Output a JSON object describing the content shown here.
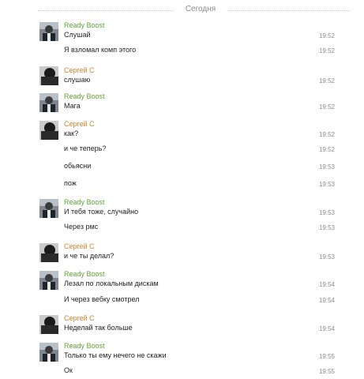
{
  "day_separator": "Сегодня",
  "users": {
    "ready_boost": {
      "name": "Ready Boost",
      "color": "#5fa535"
    },
    "sergey": {
      "name": "Сергей С",
      "color": "#d9822b"
    }
  },
  "messages": [
    {
      "text": "Слушай",
      "time": "19:52"
    },
    {
      "text": "Я взломал комп этого",
      "time": "19:52"
    },
    {
      "text": "слушаю",
      "time": "19:52"
    },
    {
      "text": "Мага",
      "time": "19:52"
    },
    {
      "text": "как?",
      "time": "19:52"
    },
    {
      "text": "и че теперь?",
      "time": "19:52"
    },
    {
      "text": "обьясни",
      "time": "19:53"
    },
    {
      "text": "пож",
      "time": "19:53"
    },
    {
      "text": "И тебя тоже, случайно",
      "time": "19:53"
    },
    {
      "text": "Через рмс",
      "time": "19:53"
    },
    {
      "text": "и че ты делал?",
      "time": "19:53"
    },
    {
      "text": "Лезал по локальным дискам",
      "time": "19:54"
    },
    {
      "text": "И через вебку смотрел",
      "time": "19:54"
    },
    {
      "text": "Неделай так больше",
      "time": "19:54"
    },
    {
      "text": "Только ты ему нечего не скажи",
      "time": "19:55"
    },
    {
      "text": "Ок",
      "time": "19:55"
    }
  ]
}
